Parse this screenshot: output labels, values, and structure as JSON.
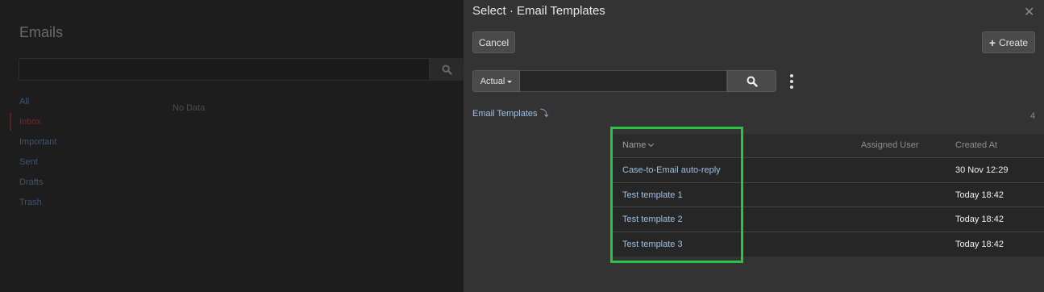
{
  "background": {
    "title": "Emails",
    "folders": [
      {
        "label": "All",
        "active": false
      },
      {
        "label": "Inbox",
        "active": true
      },
      {
        "label": "Important",
        "active": false
      },
      {
        "label": "Sent",
        "active": false
      },
      {
        "label": "Drafts",
        "active": false
      },
      {
        "label": "Trash",
        "active": false
      }
    ],
    "empty_text": "No Data"
  },
  "modal": {
    "title": "Select · Email Templates",
    "cancel_label": "Cancel",
    "create_label": "Create",
    "filter_dropdown_label": "Actual",
    "search_value": "",
    "list_heading": "Email Templates",
    "total_count": "4",
    "columns": {
      "name": "Name",
      "assigned_user": "Assigned User",
      "created_at": "Created At"
    },
    "rows": [
      {
        "name": "Case-to-Email auto-reply",
        "assigned_user": "",
        "created_at": "30 Nov 12:29"
      },
      {
        "name": "Test template 1",
        "assigned_user": "",
        "created_at": "Today 18:42"
      },
      {
        "name": "Test template 2",
        "assigned_user": "",
        "created_at": "Today 18:42"
      },
      {
        "name": "Test template 3",
        "assigned_user": "",
        "created_at": "Today 18:42"
      }
    ]
  },
  "colors": {
    "highlight": "#2bc24a",
    "link": "#9fc0e0",
    "modal_bg": "#333333"
  }
}
